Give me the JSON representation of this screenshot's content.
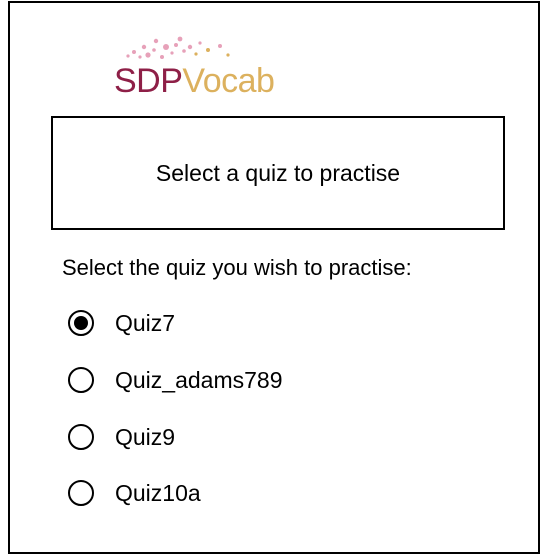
{
  "logo": {
    "text_part1": "SDP",
    "text_part2": "Vocab",
    "brand_primary_color": "#8e1f47",
    "brand_secondary_color": "#dcb15e",
    "accent_dot_color": "#e7a1b9"
  },
  "header": {
    "title": "Select a quiz to practise"
  },
  "form": {
    "prompt": "Select the quiz you wish to practise:",
    "options": [
      {
        "label": "Quiz7",
        "selected": true
      },
      {
        "label": "Quiz_adams789",
        "selected": false
      },
      {
        "label": "Quiz9",
        "selected": false
      },
      {
        "label": "Quiz10a",
        "selected": false
      }
    ]
  }
}
